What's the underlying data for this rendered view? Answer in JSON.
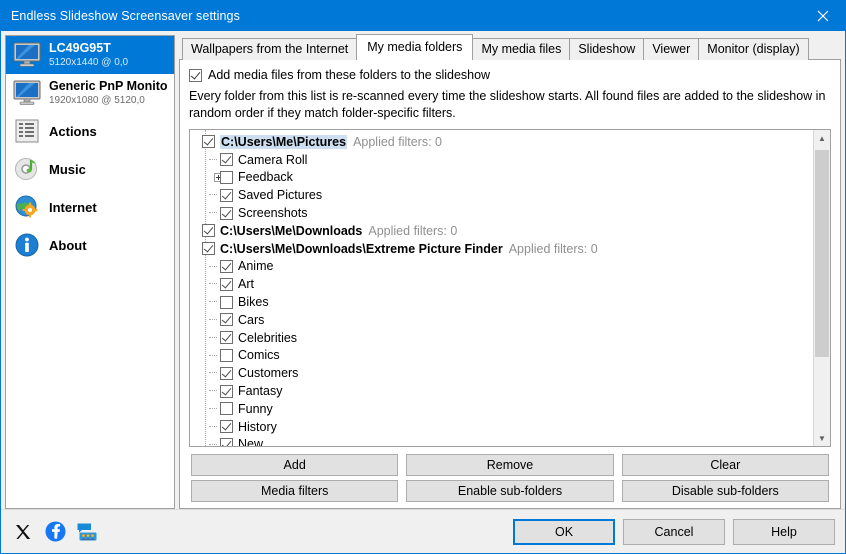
{
  "window": {
    "title": "Endless Slideshow Screensaver settings",
    "accent_color": "#0078d7",
    "close_label": "Close"
  },
  "sidebar": {
    "items": [
      {
        "icon": "monitor-icon",
        "title": "LC49G95T",
        "subtitle": "5120x1440 @ 0,0",
        "selected": true
      },
      {
        "icon": "monitor-icon",
        "title": "Generic PnP Monitor",
        "subtitle": "1920x1080 @ 5120,0",
        "selected": false
      },
      {
        "icon": "list-icon",
        "title": "Actions",
        "subtitle": "",
        "selected": false
      },
      {
        "icon": "music-disc-icon",
        "title": "Music",
        "subtitle": "",
        "selected": false
      },
      {
        "icon": "globe-gear-icon",
        "title": "Internet",
        "subtitle": "",
        "selected": false
      },
      {
        "icon": "info-icon",
        "title": "About",
        "subtitle": "",
        "selected": false
      }
    ]
  },
  "tabs": [
    {
      "label": "Wallpapers from the Internet",
      "active": false
    },
    {
      "label": "My media folders",
      "active": true
    },
    {
      "label": "My media files",
      "active": false
    },
    {
      "label": "Slideshow",
      "active": false
    },
    {
      "label": "Viewer",
      "active": false
    },
    {
      "label": "Monitor (display)",
      "active": false
    }
  ],
  "panel": {
    "enable_checkbox": {
      "label": "Add media files from these folders to the slideshow",
      "checked": true
    },
    "description": "Every folder from this list is re-scanned every time the slideshow starts. All found files are added to the slideshow in random order if they match folder-specific filters."
  },
  "tree": {
    "filters_label": "Applied filters: 0",
    "nodes": [
      {
        "level": 0,
        "expander": "minus",
        "checked": true,
        "bold": true,
        "selected": true,
        "label": "C:\\Users\\Me\\Pictures",
        "filters": "Applied filters: 0"
      },
      {
        "level": 1,
        "expander": "none",
        "checked": true,
        "bold": false,
        "selected": false,
        "label": "Camera Roll",
        "filters": ""
      },
      {
        "level": 1,
        "expander": "plus",
        "checked": false,
        "bold": false,
        "selected": false,
        "label": "Feedback",
        "filters": ""
      },
      {
        "level": 1,
        "expander": "none",
        "checked": true,
        "bold": false,
        "selected": false,
        "label": "Saved Pictures",
        "filters": ""
      },
      {
        "level": 1,
        "expander": "none",
        "checked": true,
        "bold": false,
        "selected": false,
        "label": "Screenshots",
        "filters": ""
      },
      {
        "level": 0,
        "expander": "plus",
        "checked": true,
        "bold": true,
        "selected": false,
        "label": "C:\\Users\\Me\\Downloads",
        "filters": "Applied filters: 0"
      },
      {
        "level": 0,
        "expander": "minus",
        "checked": true,
        "bold": true,
        "selected": false,
        "label": "C:\\Users\\Me\\Downloads\\Extreme Picture Finder",
        "filters": "Applied filters: 0"
      },
      {
        "level": 1,
        "expander": "none",
        "checked": true,
        "bold": false,
        "selected": false,
        "label": "Anime",
        "filters": ""
      },
      {
        "level": 1,
        "expander": "none",
        "checked": true,
        "bold": false,
        "selected": false,
        "label": "Art",
        "filters": ""
      },
      {
        "level": 1,
        "expander": "none",
        "checked": false,
        "bold": false,
        "selected": false,
        "label": "Bikes",
        "filters": ""
      },
      {
        "level": 1,
        "expander": "none",
        "checked": true,
        "bold": false,
        "selected": false,
        "label": "Cars",
        "filters": ""
      },
      {
        "level": 1,
        "expander": "none",
        "checked": true,
        "bold": false,
        "selected": false,
        "label": "Celebrities",
        "filters": ""
      },
      {
        "level": 1,
        "expander": "none",
        "checked": false,
        "bold": false,
        "selected": false,
        "label": "Comics",
        "filters": ""
      },
      {
        "level": 1,
        "expander": "none",
        "checked": true,
        "bold": false,
        "selected": false,
        "label": "Customers",
        "filters": ""
      },
      {
        "level": 1,
        "expander": "none",
        "checked": true,
        "bold": false,
        "selected": false,
        "label": "Fantasy",
        "filters": ""
      },
      {
        "level": 1,
        "expander": "none",
        "checked": false,
        "bold": false,
        "selected": false,
        "label": "Funny",
        "filters": ""
      },
      {
        "level": 1,
        "expander": "none",
        "checked": true,
        "bold": false,
        "selected": false,
        "label": "History",
        "filters": ""
      },
      {
        "level": 1,
        "expander": "none",
        "checked": true,
        "bold": false,
        "selected": false,
        "label": "New",
        "filters": ""
      }
    ]
  },
  "actions": {
    "add": "Add",
    "remove": "Remove",
    "clear": "Clear",
    "media_filters": "Media filters",
    "enable_subfolders": "Enable sub-folders",
    "disable_subfolders": "Disable sub-folders"
  },
  "footer": {
    "social": [
      {
        "name": "x-twitter-icon"
      },
      {
        "name": "facebook-icon"
      },
      {
        "name": "forum-icon"
      }
    ],
    "ok": "OK",
    "cancel": "Cancel",
    "help": "Help"
  }
}
